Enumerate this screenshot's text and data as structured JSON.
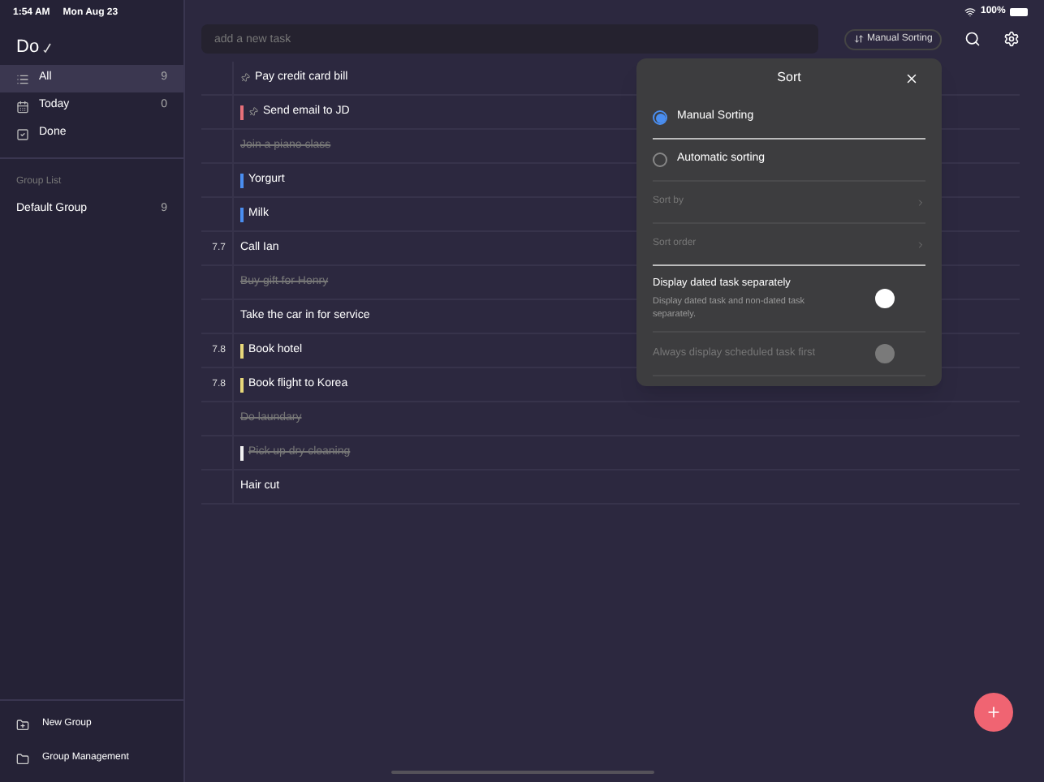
{
  "status_bar": {
    "time": "1:54 AM",
    "date": "Mon Aug 23",
    "battery": "100%"
  },
  "app_title": "Do",
  "sidebar": {
    "items": [
      {
        "label": "All",
        "count": "9",
        "kind": "list",
        "selected": true
      },
      {
        "label": "Today",
        "count": "0",
        "kind": "calendar",
        "selected": false
      },
      {
        "label": "Done",
        "kind": "check",
        "selected": false
      }
    ],
    "group_list_heading": "Group List",
    "groups": [
      {
        "label": "Default Group",
        "count": "9",
        "selected": false
      }
    ],
    "footer": [
      {
        "label": "New Group",
        "kind": "new"
      },
      {
        "label": "Group Management",
        "kind": "manage"
      }
    ]
  },
  "new_task": {
    "placeholder": "add a new task"
  },
  "sort_button": "Manual Sorting",
  "tasks": [
    {
      "title": "Pay credit card bill",
      "pinned": true,
      "done": false
    },
    {
      "title": "Send email to JD",
      "pinned": true,
      "done": false,
      "color": "#e8707a"
    },
    {
      "title": "Join a piano class",
      "pinned": false,
      "done": true
    },
    {
      "title": "Yorgurt",
      "pinned": false,
      "done": false,
      "color": "#4a8ef0"
    },
    {
      "title": "Milk",
      "pinned": false,
      "done": false,
      "color": "#4a8ef0"
    },
    {
      "date": "7.7",
      "title": "Call Ian",
      "pinned": false,
      "done": false
    },
    {
      "title": "Buy gift for Henry",
      "pinned": false,
      "done": true
    },
    {
      "title": "Take the car in for service",
      "pinned": false,
      "done": false
    },
    {
      "date": "7.8",
      "title": "Book hotel",
      "pinned": false,
      "done": false,
      "color": "#e8d87a"
    },
    {
      "date": "7.8",
      "title": "Book flight to Korea",
      "pinned": false,
      "done": false,
      "color": "#e8d87a"
    },
    {
      "title": "Do laundary",
      "pinned": false,
      "done": true
    },
    {
      "title": "Pick up dry cleaning",
      "pinned": false,
      "done": true,
      "color": "#f2f2f2"
    },
    {
      "title": "Hair cut",
      "pinned": false,
      "done": false
    }
  ],
  "sort_dialog": {
    "title": "Sort",
    "options": [
      {
        "label": "Manual Sorting",
        "selected": true
      },
      {
        "label": "Automatic sorting",
        "selected": false
      }
    ],
    "settings": [
      {
        "label": "Sort by",
        "disabled": true
      },
      {
        "label": "Sort order",
        "disabled": true
      }
    ],
    "toggles": [
      {
        "label": "Display dated task separately",
        "description": "Display dated task and non-dated task separately.",
        "on": false,
        "disabled": false
      },
      {
        "label": "Always display scheduled task first",
        "on": false,
        "disabled": true
      }
    ]
  }
}
